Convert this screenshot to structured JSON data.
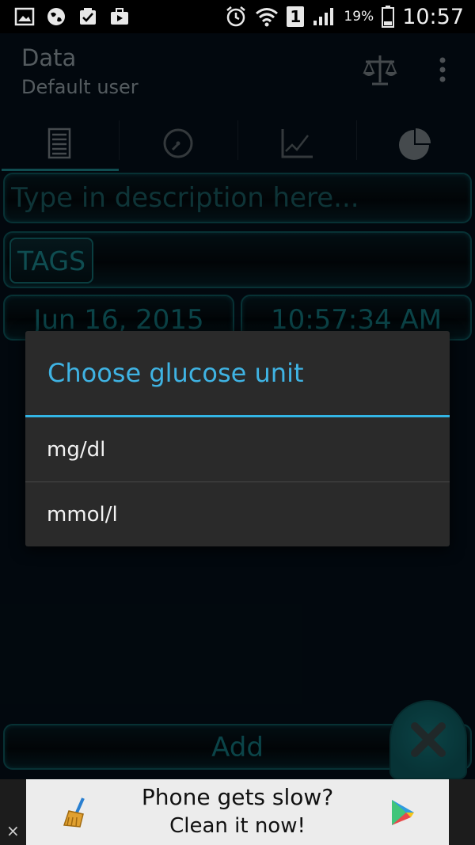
{
  "status_bar": {
    "battery_percent": "19%",
    "sim_slot": "1",
    "clock": "10:57",
    "icons": [
      "gallery-icon",
      "globe-icon",
      "clipboard-check-icon",
      "briefcase-icon",
      "alarm-icon",
      "wifi-icon",
      "signal-icon",
      "battery-icon"
    ]
  },
  "header": {
    "title": "Data",
    "subtitle": "Default user",
    "actions": [
      "scale-icon",
      "overflow-menu-icon"
    ]
  },
  "tabs": [
    {
      "icon": "list-icon",
      "active": true
    },
    {
      "icon": "gauge-icon",
      "active": false
    },
    {
      "icon": "line-chart-icon",
      "active": false
    },
    {
      "icon": "pie-chart-icon",
      "active": false
    }
  ],
  "form": {
    "description_placeholder": "Type in description here...",
    "tags_label": "TAGS",
    "date": "Jun 16, 2015",
    "time": "10:57:34 AM",
    "add_label": "Add"
  },
  "dialog": {
    "title": "Choose glucose unit",
    "options": [
      "mg/dl",
      "mmol/l"
    ]
  },
  "ad": {
    "line1": "Phone gets slow?",
    "line2": "Clean it now!",
    "close_label": "×"
  },
  "colors": {
    "accent": "#33b5e5",
    "teal": "#157d84",
    "background": "#04101a",
    "dialog_bg": "#2a2a2a"
  }
}
